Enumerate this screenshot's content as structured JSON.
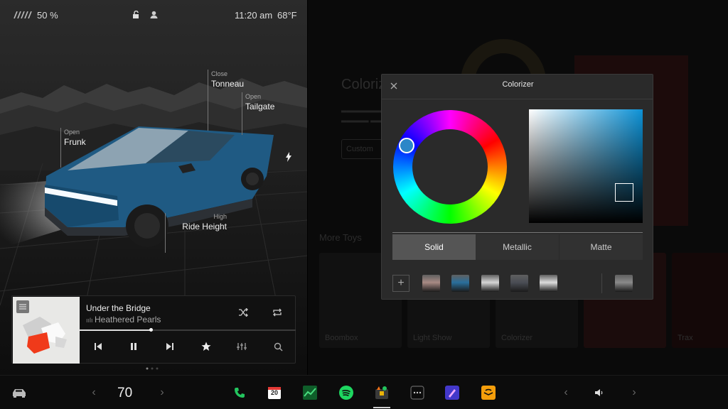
{
  "status": {
    "battery_pct": "50 %",
    "time": "11:20 am",
    "temperature": "68°F"
  },
  "callouts": {
    "tonneau": {
      "action": "Close",
      "label": "Tonneau"
    },
    "tailgate": {
      "action": "Open",
      "label": "Tailgate"
    },
    "frunk": {
      "action": "Open",
      "label": "Frunk"
    },
    "ride_height": {
      "action": "High",
      "label": "Ride Height"
    }
  },
  "media": {
    "title": "Under the Bridge",
    "artist": "Heathered Pearls",
    "progress": 0.33
  },
  "background": {
    "title": "Colorizer",
    "custom_label": "Custom",
    "more_toys": "More Toys",
    "tiles": [
      "Boombox",
      "Light Show",
      "Colorizer",
      "Trax"
    ]
  },
  "colorizer": {
    "title": "Colorizer",
    "finishes": [
      {
        "label": "Solid",
        "active": true
      },
      {
        "label": "Metallic",
        "active": false
      },
      {
        "label": "Matte",
        "active": false
      }
    ],
    "add_label": "+",
    "swatches": [
      "#a88a84",
      "#2a6f9c",
      "#d6d6d6",
      "#4a4d55",
      "#dcdcdc"
    ],
    "saved_swatch": "#8a8a8a",
    "selected_color": "#0d92d6"
  },
  "taskbar": {
    "speed": "70",
    "calendar_day": "20"
  }
}
